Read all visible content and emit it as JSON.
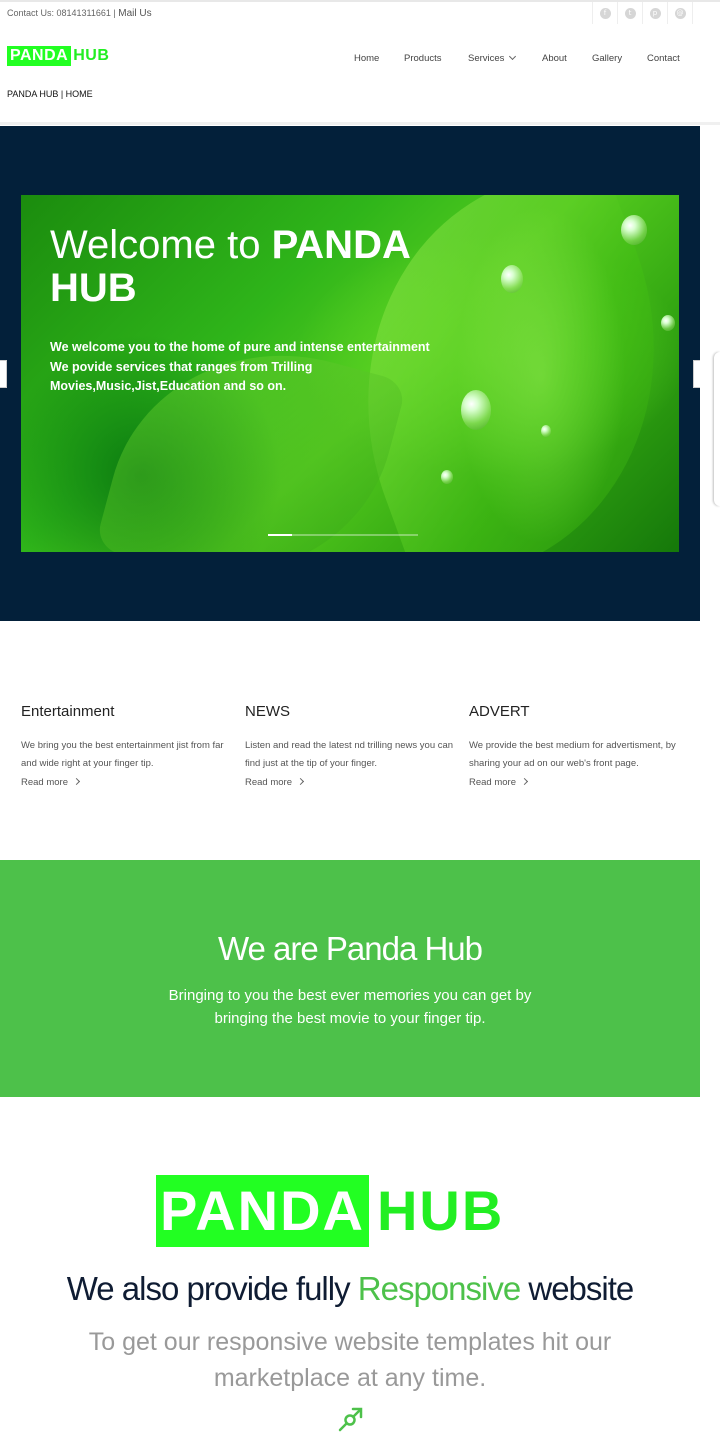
{
  "topbar": {
    "contact_text": "Contact Us: 08141311661 |",
    "mail_link": "Mail Us",
    "social_icons": [
      "facebook-icon",
      "twitter-icon",
      "pinterest-icon",
      "email-icon"
    ]
  },
  "logo": {
    "part1": "PANDA",
    "part2": "HUB"
  },
  "nav": {
    "items": [
      "Home",
      "Products",
      "Services",
      "About",
      "Gallery",
      "Contact"
    ]
  },
  "breadcrumb": "PANDA HUB | HOME",
  "hero": {
    "welcome_plain": "Welcome to",
    "welcome_bold": "PANDA HUB",
    "lines": [
      "We welcome you to the home of pure and intense entertainment",
      "We povide services that ranges from Trilling",
      "Movies,Music,Jist,Education and so on."
    ]
  },
  "features": [
    {
      "title": "Entertainment",
      "text": "We bring you the best entertainment jist from far and wide right at your finger tip.",
      "link": "Read more"
    },
    {
      "title": "NEWS",
      "text": "Listen and read the latest nd trilling news you can find just at the tip of your finger.",
      "link": "Read more"
    },
    {
      "title": "ADVERT",
      "text": "We provide the best medium for advertisment, by sharing your ad on our web's front page.",
      "link": "Read more"
    }
  ],
  "about_band": {
    "heading": "We are Panda Hub",
    "text": "Bringing to you the best ever memories you can get by bringing the best movie to your finger tip."
  },
  "responsive": {
    "before": "We also provide fully",
    "highlight": "Responsive",
    "after": "website",
    "subtext": "To get our responsive website templates hit our marketplace at any time."
  },
  "colors": {
    "accent": "#4dc14a",
    "logo_green": "#22ff22",
    "hero_bg": "#03203a"
  }
}
